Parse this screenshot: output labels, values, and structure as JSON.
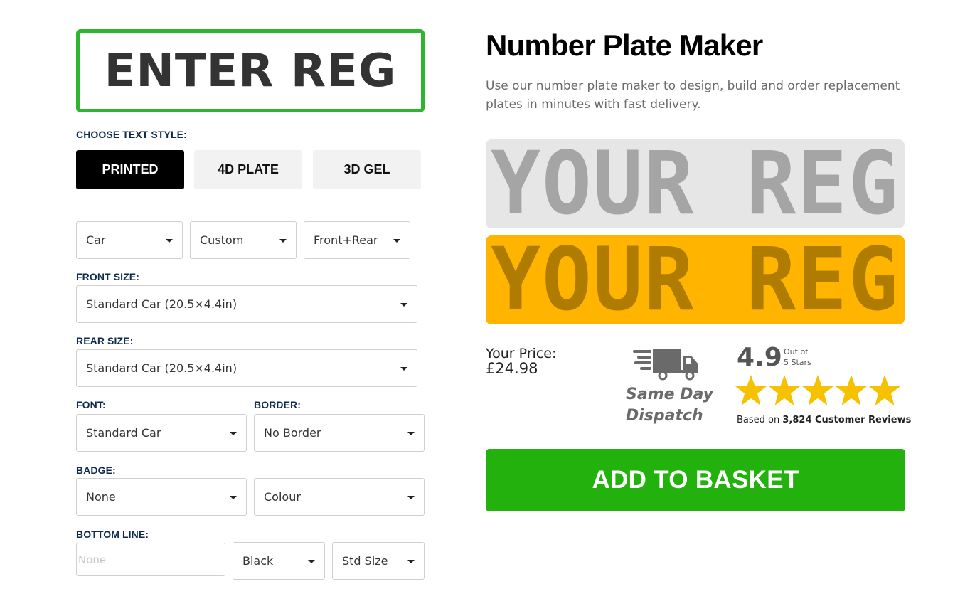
{
  "reg_input": {
    "placeholder": "ENTER REG"
  },
  "text_style": {
    "label": "CHOOSE TEXT STYLE:",
    "options": [
      "PRINTED",
      "4D PLATE",
      "3D GEL"
    ],
    "selected": "PRINTED"
  },
  "vehicle_selects": {
    "vehicle": "Car",
    "type": "Custom",
    "plates": "Front+Rear"
  },
  "front_size": {
    "label": "FRONT SIZE:",
    "value": "Standard Car (20.5×4.4in)"
  },
  "rear_size": {
    "label": "REAR SIZE:",
    "value": "Standard Car (20.5×4.4in)"
  },
  "font": {
    "label": "FONT:",
    "value": "Standard Car"
  },
  "border": {
    "label": "BORDER:",
    "value": "No Border"
  },
  "badge": {
    "label": "BADGE:",
    "value": "None",
    "colour": "Colour"
  },
  "bottom_line": {
    "label": "BOTTOM LINE:",
    "placeholder": "None",
    "colour": "Black",
    "size": "Std Size"
  },
  "header": {
    "title": "Number Plate Maker",
    "intro": "Use our number plate maker to design, build and order replacement plates in minutes with fast delivery."
  },
  "preview": {
    "front_text": "YOUR REG",
    "rear_text": "YOUR REG",
    "colors": {
      "front_bg": "#e6e6e6",
      "rear_bg": "#ffb400"
    }
  },
  "price": {
    "label": "Your Price:",
    "value": "£24.98"
  },
  "dispatch": {
    "line1": "Same Day",
    "line2": "Dispatch",
    "icon": "delivery-truck-icon"
  },
  "rating": {
    "score": "4.9",
    "out_of_line1": "Out of",
    "out_of_line2": "5 Stars",
    "stars": 5,
    "reviews_prefix": "Based on",
    "reviews_count": "3,824 Customer Reviews"
  },
  "cta": {
    "label": "ADD TO BASKET"
  },
  "colors": {
    "accent_green": "#23b10d",
    "label_navy": "#0e2b4e",
    "star_yellow": "#f6c200"
  }
}
